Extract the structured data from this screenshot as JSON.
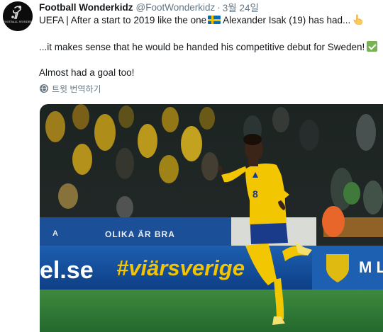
{
  "author": {
    "display_name": "Football Wonderkidz",
    "handle": "@FootWonderkidz",
    "separator": "·",
    "timestamp": "3월 24일",
    "avatar_text": "FOOTBALL WONDERKIDZ"
  },
  "tweet": {
    "line1_text": "UEFA | After a start to 2019 like the one",
    "line1_text_after_flag": "Alexander Isak (19) has had...",
    "line2_text": "...it makes sense that he would be handed his competitive debut for Sweden!",
    "line3_text": "Almost had a goal too!",
    "translate_label": "트윗 번역하기",
    "emoji": {
      "flag": "sweden-flag-icon",
      "hand": "pointing-up-hand-icon",
      "check": "check-mark-icon"
    }
  },
  "photo": {
    "ad_boards": {
      "upper_left": "OLIKA ÄR BRA",
      "lower_left": "el.se",
      "lower_middle": "#viärsverige",
      "lower_right_partial": "M Le"
    },
    "shirt_number": "8"
  },
  "colors": {
    "text": "#14171a",
    "secondary_text": "#657786",
    "sweden_blue": "#0a6bb3",
    "sweden_yellow": "#f5c400",
    "pitch_green": "#2e7a36",
    "check_green": "#77b255"
  }
}
